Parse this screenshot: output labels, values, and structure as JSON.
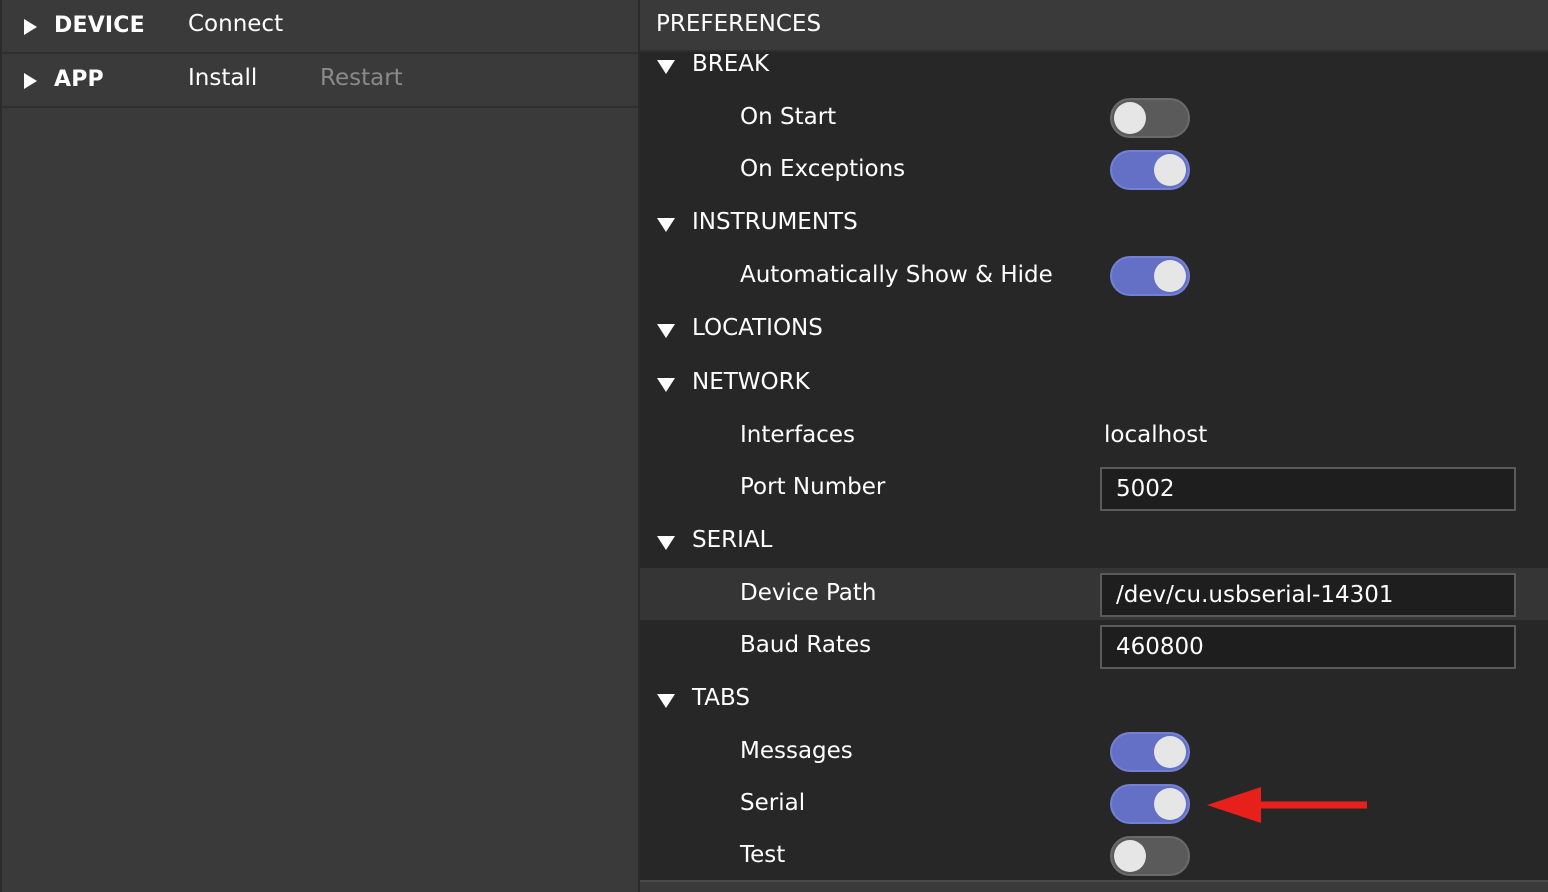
{
  "left_panel": {
    "rows": [
      {
        "section": "DEVICE",
        "actions": [
          {
            "label": "Connect",
            "enabled": true
          }
        ]
      },
      {
        "section": "APP",
        "actions": [
          {
            "label": "Install",
            "enabled": true
          },
          {
            "label": "Restart",
            "enabled": false
          }
        ]
      }
    ]
  },
  "preferences": {
    "title": "PREFERENCES",
    "break": {
      "label": "BREAK",
      "on_start": {
        "label": "On Start",
        "enabled": false
      },
      "on_exceptions": {
        "label": "On Exceptions",
        "enabled": true
      }
    },
    "instruments": {
      "label": "INSTRUMENTS",
      "auto_show_hide": {
        "label": "Automatically Show & Hide",
        "enabled": true
      }
    },
    "locations": {
      "label": "LOCATIONS"
    },
    "network": {
      "label": "NETWORK",
      "interfaces": {
        "label": "Interfaces",
        "value": "localhost"
      },
      "port_number": {
        "label": "Port Number",
        "value": "5002"
      }
    },
    "serial": {
      "label": "SERIAL",
      "device_path": {
        "label": "Device Path",
        "value": "/dev/cu.usbserial-14301"
      },
      "baud_rates": {
        "label": "Baud Rates",
        "value": "460800"
      }
    },
    "tabs": {
      "label": "TABS",
      "messages": {
        "label": "Messages",
        "enabled": true
      },
      "serial": {
        "label": "Serial",
        "enabled": true
      },
      "test": {
        "label": "Test",
        "enabled": false
      }
    }
  },
  "colors": {
    "toggle_on": "#6470c6",
    "toggle_off": "#5a5a5a",
    "annotation_arrow": "#e8201c"
  }
}
